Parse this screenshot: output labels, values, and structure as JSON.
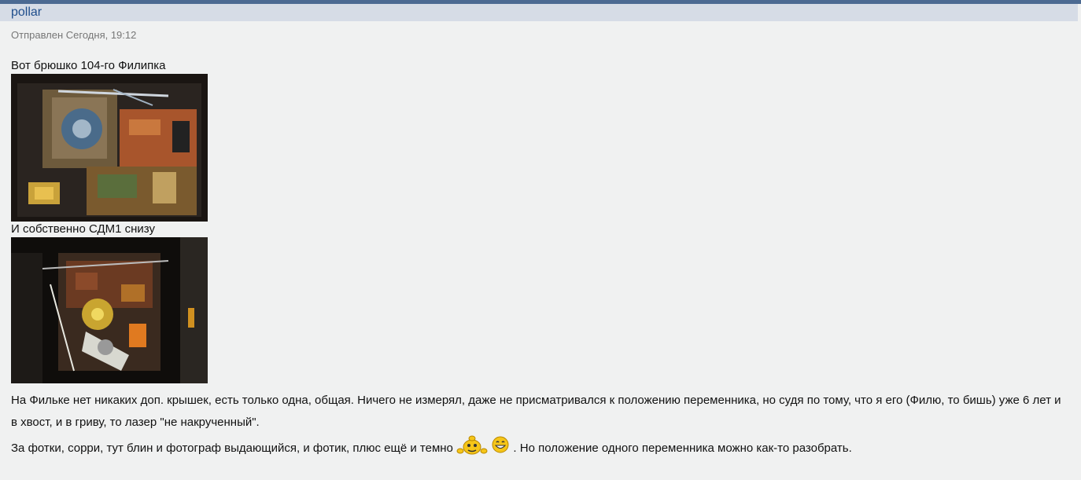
{
  "post": {
    "author": "pollar",
    "sent": "Отправлен Сегодня, 19:12",
    "caption1": "Вот брюшко 104-го Филипка",
    "caption2": "И собственно СДМ1 снизу",
    "para1": "На Фильке нет никаких доп. крышек, есть только одна, общая. Ничего не измерял, даже не присматривался к положению переменника, но судя по тому, что я его (Филю, то бишь) уже 6 лет и в хвост, и в гриву, то лазер \"не накрученный\".",
    "para2_start": "За фотки, сорри, тут блин и фотограф выдающийся, и фотик, плюс ещё и темно",
    "para2_end": ". Но положение одного переменника можно как-то разобрать."
  },
  "icons": {
    "smiley1": "smiley-scratching-icon",
    "smiley2": "smiley-grin-icon"
  },
  "colors": {
    "header_bar": "#4c6a92",
    "author_bar": "#d6dce6",
    "author_link": "#1f4e8c",
    "background": "#f0f1f1"
  }
}
